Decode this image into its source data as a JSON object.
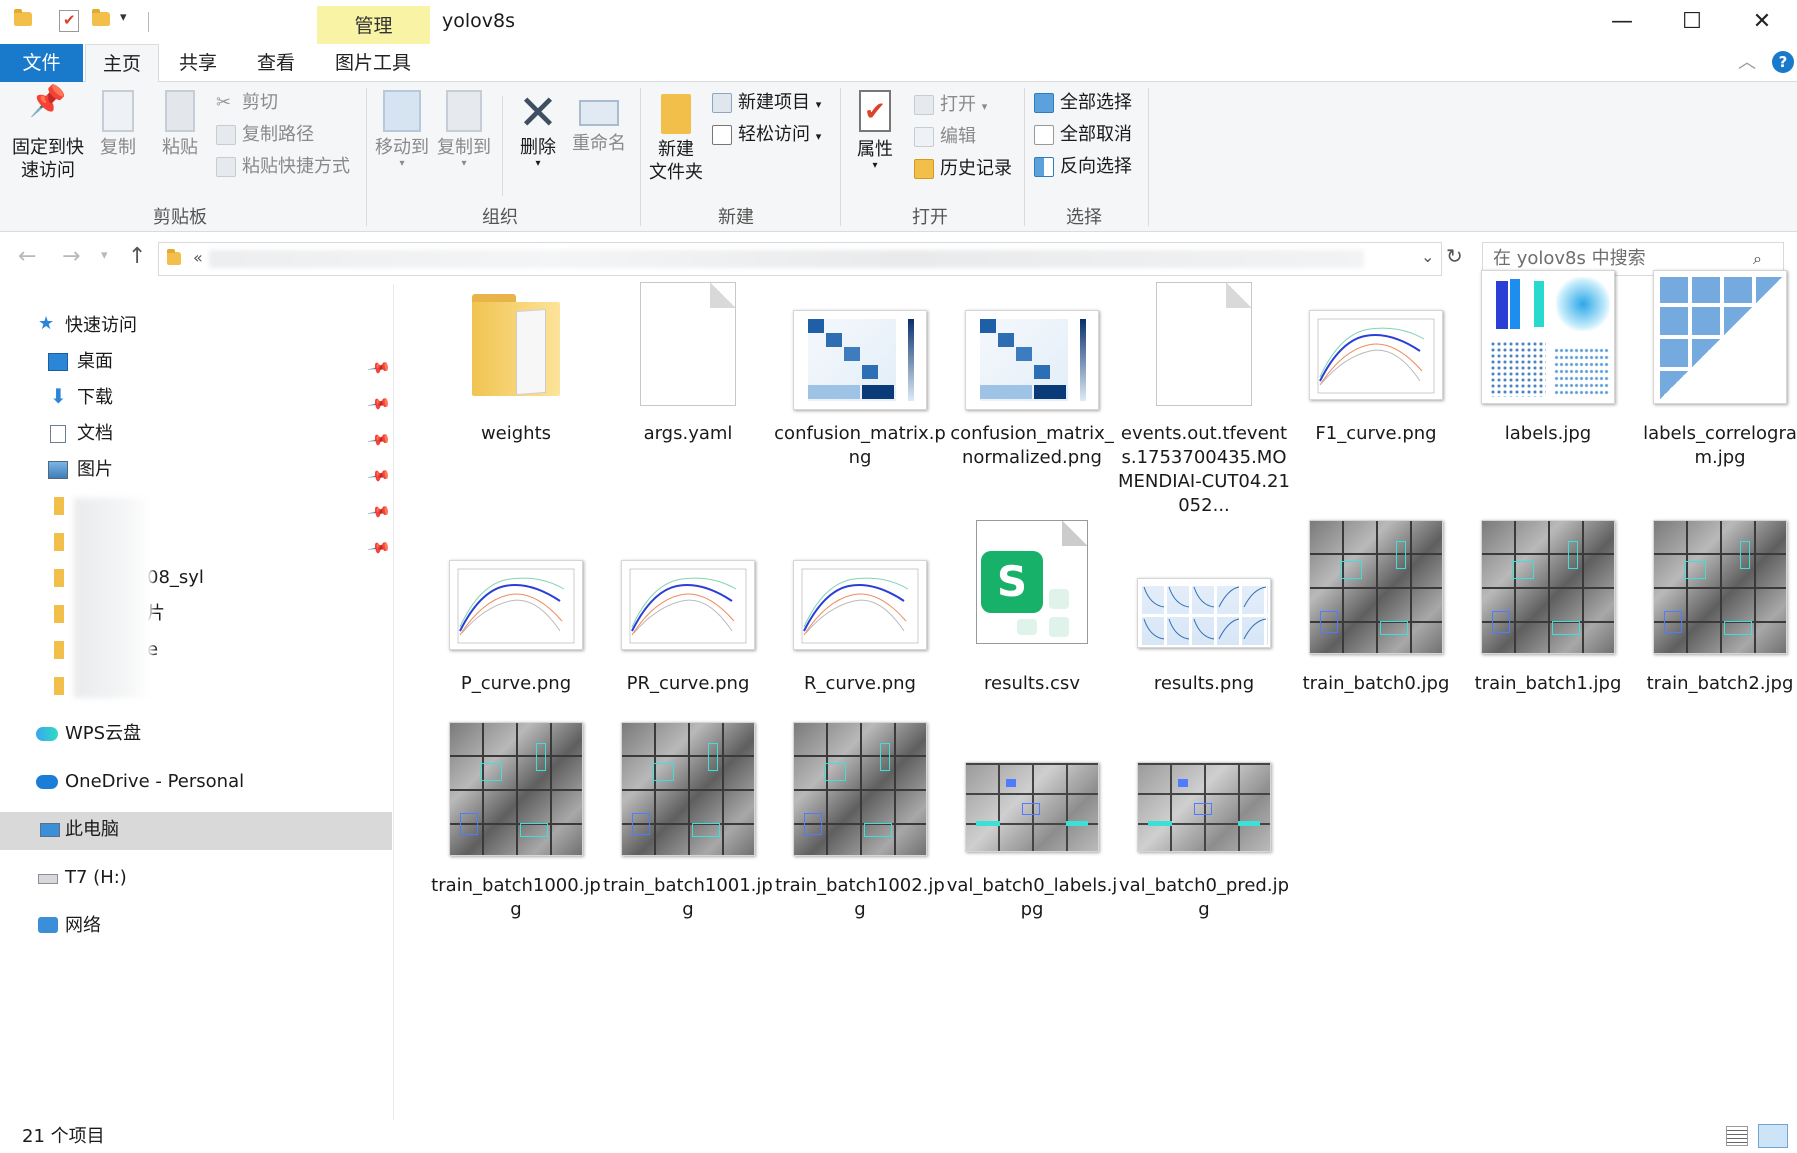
{
  "window": {
    "title": "yolov8s",
    "manage_tab": "管理",
    "minimize": "—",
    "maximize": "☐",
    "close": "✕"
  },
  "ribbon_tabs": [
    "文件",
    "主页",
    "共享",
    "查看",
    "图片工具"
  ],
  "ribbon": {
    "clipboard": {
      "pin_label": "固定到快速访问",
      "copy": "复制",
      "paste": "粘贴",
      "cut": "剪切",
      "copy_path": "复制路径",
      "paste_shortcut": "粘贴快捷方式",
      "group": "剪贴板"
    },
    "organize": {
      "move_to": "移动到",
      "copy_to": "复制到",
      "delete": "删除",
      "rename": "重命名",
      "group": "组织"
    },
    "new": {
      "new_item": "新建项目",
      "easy_access": "轻松访问",
      "new_folder_1": "新建",
      "new_folder_2": "文件夹",
      "group": "新建"
    },
    "open": {
      "properties": "属性",
      "open": "打开",
      "edit": "编辑",
      "history": "历史记录",
      "group": "打开"
    },
    "select": {
      "select_all": "全部选择",
      "select_none": "全部取消",
      "invert": "反向选择",
      "group": "选择"
    }
  },
  "address": {
    "prefix": "«",
    "search_placeholder": "在 yolov8s 中搜索"
  },
  "nav": {
    "quick_access": "快速访问",
    "desktop": "桌面",
    "downloads": "下载",
    "documents": "文档",
    "pictures": "图片",
    "partial_1": "08_syl",
    "partial_2": "片",
    "partial_3": "e",
    "wps": "WPS云盘",
    "onedrive": "OneDrive - Personal",
    "this_pc": "此电脑",
    "drive": "T7 (H:)",
    "network": "网络"
  },
  "files": [
    {
      "name": "weights",
      "type": "folder"
    },
    {
      "name": "args.yaml",
      "type": "doc"
    },
    {
      "name": "confusion_matrix.png",
      "type": "matrix"
    },
    {
      "name": "confusion_matrix_normalized.png",
      "type": "matrix"
    },
    {
      "name": "events.out.tfevents.1753700435.MOMENDIAI-CUT04.21052...",
      "type": "doc"
    },
    {
      "name": "F1_curve.png",
      "type": "curve"
    },
    {
      "name": "labels.jpg",
      "type": "labels"
    },
    {
      "name": "labels_correlogram.jpg",
      "type": "correlogram"
    },
    {
      "name": "P_curve.png",
      "type": "curve"
    },
    {
      "name": "PR_curve.png",
      "type": "curve"
    },
    {
      "name": "R_curve.png",
      "type": "curve"
    },
    {
      "name": "results.csv",
      "type": "csv"
    },
    {
      "name": "results.png",
      "type": "results"
    },
    {
      "name": "train_batch0.jpg",
      "type": "batch"
    },
    {
      "name": "train_batch1.jpg",
      "type": "batch"
    },
    {
      "name": "train_batch2.jpg",
      "type": "batch"
    },
    {
      "name": "train_batch1000.jpg",
      "type": "batch"
    },
    {
      "name": "train_batch1001.jpg",
      "type": "batch"
    },
    {
      "name": "train_batch1002.jpg",
      "type": "batch"
    },
    {
      "name": "val_batch0_labels.jpg",
      "type": "valbatch"
    },
    {
      "name": "val_batch0_pred.jpg",
      "type": "valbatch"
    }
  ],
  "status": {
    "count": "21 个项目"
  },
  "colors": {
    "accent": "#1979ca",
    "manage_tab": "#f8f3a5",
    "selected_nav": "#d9d9d9"
  }
}
